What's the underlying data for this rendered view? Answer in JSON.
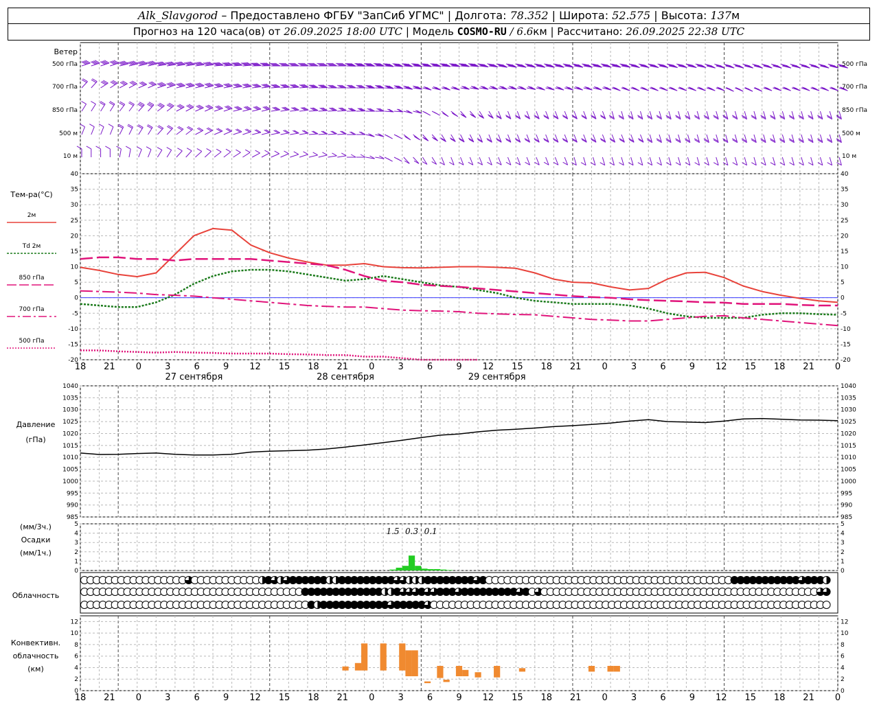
{
  "header": {
    "station": "Alk_Slavgorod",
    "provider_text": "– Предоставлено ФГБУ \"ЗапСиб УГМС\"",
    "lon_label": "Долгота:",
    "lon_value": "78.352",
    "lat_label": "Широта:",
    "lat_value": "52.575",
    "alt_label": "Высота:",
    "alt_value": "137",
    "alt_unit": "м",
    "forecast_text": "Прогноз на 120 часа(ов) от",
    "forecast_date": "26.09.2025 18:00 UTC",
    "model_label": "| Модель",
    "model_name": "COSMO-RU",
    "model_res": "/ 6.6",
    "model_res_unit": "км",
    "calc_label": "| Рассчитано:",
    "calc_date": "26.09.2025 22:38 UTC"
  },
  "labels": {
    "wind": "Ветер",
    "wind_levels": [
      "500 гПа",
      "700 гПа",
      "850 гПа",
      "500 м",
      "10 м"
    ],
    "temp": "Тем-ра(°C)",
    "legend": [
      {
        "text": "2м",
        "color": "#e8423a",
        "dash": "solid"
      },
      {
        "text": "Td 2м",
        "color": "#1a7a1a",
        "dash": "dot"
      },
      {
        "text": "850 гПа",
        "color": "#e0137a",
        "dash": "long"
      },
      {
        "text": "700 гПа",
        "color": "#e0137a",
        "dash": "dashdot"
      },
      {
        "text": "500 гПа",
        "color": "#e0137a",
        "dash": "dense"
      }
    ],
    "pressure": "Давление",
    "pressure_unit": "(гПа)",
    "precip_top": "(мм/3ч.)",
    "precip_mid": "Осадки",
    "precip_bot": "(мм/1ч.)",
    "cloud": "Облачность",
    "conv_1": "Конвективн.",
    "conv_2": "облачность",
    "conv_3": "(км)",
    "dates": [
      "27 сентября",
      "28 сентября",
      "29 сентября"
    ],
    "hour_ticks": [
      "18",
      "21",
      "0",
      "3",
      "6",
      "9",
      "12",
      "15",
      "18",
      "21",
      "0",
      "3",
      "6",
      "9",
      "12",
      "15",
      "18",
      "21",
      "0",
      "3",
      "6",
      "9",
      "12",
      "15",
      "18",
      "21",
      "0"
    ]
  },
  "colors": {
    "wind": "#7a17c8",
    "t2m": "#e8423a",
    "td": "#1a7a1a",
    "pres_levels": "#e0137a",
    "precip": "#22cc22",
    "convective": "#f08a30"
  },
  "chart_data": [
    {
      "type": "line",
      "title": "Тем-ра(°C)",
      "x_unit": "hours from 26.09.2025 18:00 UTC",
      "ylim": [
        -20,
        40
      ],
      "series": [
        {
          "name": "2м",
          "x": [
            0,
            3,
            6,
            9,
            12,
            15,
            18,
            21,
            24,
            27,
            30,
            33,
            36,
            39,
            42,
            45,
            48,
            51,
            54,
            57,
            60,
            63,
            66,
            69,
            72,
            75,
            78,
            81,
            84,
            87,
            90,
            93,
            96,
            99,
            102,
            105,
            108,
            111,
            114,
            117,
            120
          ],
          "values": [
            9.8,
            8.8,
            7.5,
            6.8,
            8,
            14,
            20,
            22.3,
            21.8,
            17,
            14.5,
            12.8,
            11.5,
            10.5,
            10.5,
            11,
            10,
            9.7,
            9.6,
            9.8,
            10,
            10,
            9.8,
            9.5,
            8,
            6,
            5,
            4.8,
            3.5,
            2.5,
            3,
            6,
            8,
            8.2,
            6.5,
            3.8,
            2,
            0.8,
            -0.2,
            -1,
            -1.5
          ]
        },
        {
          "name": "Td 2м",
          "x": [
            0,
            3,
            6,
            9,
            12,
            15,
            18,
            21,
            24,
            27,
            30,
            33,
            36,
            39,
            42,
            45,
            48,
            51,
            54,
            57,
            60,
            63,
            66,
            69,
            72,
            75,
            78,
            81,
            84,
            87,
            90,
            93,
            96,
            99,
            102,
            105,
            108,
            111,
            114,
            117,
            120
          ],
          "values": [
            -2,
            -2.5,
            -3,
            -3,
            -1.5,
            1,
            4.5,
            7,
            8.5,
            9,
            9,
            8.5,
            7.5,
            6.5,
            5.5,
            6,
            7,
            6,
            5,
            4,
            3.5,
            2.5,
            1.5,
            0,
            -1,
            -1.5,
            -2,
            -2,
            -2,
            -2.5,
            -3.5,
            -5,
            -6,
            -6.5,
            -6.5,
            -6.5,
            -5.5,
            -5,
            -5,
            -5.3,
            -5.5
          ]
        },
        {
          "name": "850 гПа",
          "x": [
            0,
            3,
            6,
            9,
            12,
            15,
            18,
            21,
            24,
            27,
            30,
            33,
            36,
            39,
            42,
            45,
            48,
            51,
            54,
            57,
            60,
            63,
            66,
            69,
            72,
            75,
            78,
            81,
            84,
            87,
            90,
            93,
            96,
            99,
            102,
            105,
            108,
            111,
            114,
            117,
            120
          ],
          "values": [
            12.5,
            13,
            13,
            12.5,
            12.5,
            12,
            12.5,
            12.5,
            12.5,
            12.5,
            12,
            11.5,
            11,
            10.5,
            9,
            7,
            5.5,
            5,
            4.2,
            3.8,
            3.5,
            3,
            2.5,
            2,
            1.5,
            1,
            0.5,
            0.2,
            0,
            -0.5,
            -0.8,
            -1,
            -1.2,
            -1.5,
            -1.6,
            -2,
            -2,
            -2,
            -2.3,
            -2.5,
            -2.5
          ]
        },
        {
          "name": "700 гПа",
          "x": [
            0,
            3,
            6,
            9,
            12,
            15,
            18,
            21,
            24,
            27,
            30,
            33,
            36,
            39,
            42,
            45,
            48,
            51,
            54,
            57,
            60,
            63,
            66,
            69,
            72,
            75,
            78,
            81,
            84,
            87,
            90,
            93,
            96,
            99,
            102,
            105,
            108,
            111,
            114,
            117,
            120
          ],
          "values": [
            2.2,
            2,
            1.8,
            1.5,
            1,
            0.8,
            0.5,
            0,
            -0.5,
            -1,
            -1.5,
            -2,
            -2.5,
            -2.8,
            -3,
            -3,
            -3.5,
            -4,
            -4.2,
            -4.3,
            -4.5,
            -5,
            -5.2,
            -5.4,
            -5.5,
            -6,
            -6.5,
            -7,
            -7.2,
            -7.5,
            -7.5,
            -7,
            -6.5,
            -6,
            -5.8,
            -6.5,
            -7,
            -7.5,
            -8,
            -8.5,
            -9
          ]
        },
        {
          "name": "500 гПа",
          "x": [
            0,
            3,
            6,
            9,
            12,
            15,
            18,
            21,
            24,
            27,
            30,
            33,
            36,
            39,
            42,
            45,
            48,
            51,
            54,
            57,
            60,
            63
          ],
          "values": [
            -17,
            -17,
            -17.3,
            -17.5,
            -17.7,
            -17.5,
            -17.7,
            -17.8,
            -18,
            -18,
            -18,
            -18.2,
            -18.3,
            -18.5,
            -18.5,
            -19,
            -19,
            -19.5,
            -20,
            -20,
            -20,
            -20
          ]
        }
      ]
    },
    {
      "type": "line",
      "title": "Давление",
      "ylabel": "(гПа)",
      "ylim": [
        985,
        1040
      ],
      "series": [
        {
          "name": "Давление",
          "x": [
            0,
            3,
            6,
            9,
            12,
            15,
            18,
            21,
            24,
            27,
            30,
            33,
            36,
            39,
            42,
            45,
            48,
            51,
            54,
            57,
            60,
            63,
            66,
            69,
            72,
            75,
            78,
            81,
            84,
            87,
            90,
            93,
            96,
            99,
            102,
            105,
            108,
            111,
            114,
            117,
            120
          ],
          "values": [
            1011.8,
            1011.2,
            1011.3,
            1011.6,
            1011.8,
            1011.3,
            1011,
            1011,
            1011.3,
            1012.2,
            1012.6,
            1012.8,
            1013,
            1013.5,
            1014.3,
            1015.2,
            1016.2,
            1017.2,
            1018.3,
            1019.3,
            1019.8,
            1020.7,
            1021.4,
            1021.8,
            1022.3,
            1022.9,
            1023.3,
            1023.8,
            1024.4,
            1025.2,
            1025.8,
            1025,
            1024.8,
            1024.6,
            1025.2,
            1026.1,
            1026.3,
            1026,
            1025.7,
            1025.6,
            1025.4
          ]
        }
      ]
    },
    {
      "type": "bar",
      "title": "Осадки",
      "ylabel": "(мм/1ч.)",
      "ylim": [
        0,
        5
      ],
      "x": [
        45,
        46,
        47,
        48,
        49,
        50,
        51,
        52,
        53,
        54,
        55,
        56,
        57,
        58
      ],
      "values": [
        0,
        0,
        0,
        0,
        0.1,
        0.3,
        0.5,
        1.6,
        0.5,
        0.2,
        0.15,
        0.15,
        0.1,
        0.05
      ],
      "annotations": [
        {
          "x": 49.5,
          "text": "1.5"
        },
        {
          "x": 52.5,
          "text": "0.3"
        },
        {
          "x": 55.5,
          "text": "0.1"
        }
      ]
    },
    {
      "type": "bar",
      "title": "Конвективн. облачность",
      "ylabel": "(км)",
      "ylim": [
        0,
        13
      ],
      "segments": [
        {
          "x": 42,
          "bottom": 3.5,
          "top": 4.2
        },
        {
          "x": 44,
          "bottom": 3.5,
          "top": 4.8
        },
        {
          "x": 45,
          "bottom": 3.5,
          "top": 8.2
        },
        {
          "x": 48,
          "bottom": 3.5,
          "top": 8.2
        },
        {
          "x": 51,
          "bottom": 3.5,
          "top": 8.2
        },
        {
          "x": 52,
          "bottom": 2.5,
          "top": 7
        },
        {
          "x": 53,
          "bottom": 2.5,
          "top": 7
        },
        {
          "x": 55,
          "bottom": 1.3,
          "top": 1.6
        },
        {
          "x": 57,
          "bottom": 2.2,
          "top": 4.3
        },
        {
          "x": 58,
          "bottom": 1.5,
          "top": 1.9
        },
        {
          "x": 60,
          "bottom": 2.5,
          "top": 4.3
        },
        {
          "x": 61,
          "bottom": 2.5,
          "top": 3.6
        },
        {
          "x": 63,
          "bottom": 2.3,
          "top": 3.2
        },
        {
          "x": 66,
          "bottom": 2.3,
          "top": 4.3
        },
        {
          "x": 70,
          "bottom": 3.3,
          "top": 3.9
        },
        {
          "x": 81,
          "bottom": 3.3,
          "top": 4.3
        },
        {
          "x": 84,
          "bottom": 3.3,
          "top": 4.3
        },
        {
          "x": 85,
          "bottom": 3.3,
          "top": 4.3
        }
      ]
    }
  ],
  "cloud_rows": [
    "00000000000000000300000000000213231111112211111111133222111111113100000000000000000000000000000000000000001111111111131112",
    "00000000000000000000000000000000000011111111111112213331331113111111111310300000000000000000000000000000000000000000000033",
    "00000000000000000000000000000000000001211111111111311111300000000000000000000000000000000000000000000000000000000000000000"
  ],
  "wind_rows": [
    {
      "level": "500 гПа",
      "dir": [
        250,
        250,
        255,
        255,
        260,
        260,
        262,
        265,
        265,
        268,
        270,
        270,
        270,
        270,
        272,
        272,
        275,
        275,
        275,
        275,
        275,
        278,
        280,
        280,
        280,
        280,
        280,
        280,
        280,
        282,
        282,
        282,
        282,
        285,
        285,
        285,
        285,
        285,
        285,
        285,
        285
      ],
      "speed": [
        40,
        42,
        45,
        45,
        45,
        45,
        45,
        45,
        45,
        45,
        45,
        45,
        45,
        45,
        45,
        45,
        45,
        45,
        45,
        45,
        45,
        45,
        45,
        45,
        45,
        45,
        45,
        45,
        45,
        45,
        45,
        45,
        45,
        45,
        45,
        45,
        45,
        45,
        45,
        45,
        45
      ]
    },
    {
      "level": "700 гПа",
      "dir": [
        220,
        235,
        240,
        245,
        250,
        255,
        255,
        258,
        260,
        262,
        265,
        265,
        268,
        270,
        270,
        272,
        275,
        280,
        285,
        285,
        280,
        280,
        280,
        282,
        285,
        285,
        285,
        285,
        290,
        290,
        290,
        290,
        290,
        290,
        295,
        295,
        290,
        290,
        290,
        290,
        290
      ],
      "speed": [
        20,
        25,
        30,
        32,
        35,
        35,
        35,
        35,
        35,
        35,
        35,
        35,
        35,
        35,
        35,
        35,
        35,
        35,
        30,
        30,
        30,
        30,
        30,
        30,
        30,
        30,
        30,
        30,
        30,
        30,
        30,
        30,
        30,
        30,
        30,
        30,
        30,
        30,
        30,
        30,
        30
      ]
    },
    {
      "level": "850 гПа",
      "dir": [
        210,
        210,
        215,
        220,
        230,
        240,
        245,
        250,
        255,
        255,
        260,
        262,
        265,
        265,
        268,
        270,
        275,
        285,
        300,
        310,
        320,
        330,
        340,
        340,
        340,
        340,
        340,
        340,
        345,
        345,
        345,
        345,
        345,
        345,
        345,
        345,
        345,
        345,
        345,
        345,
        345
      ],
      "speed": [
        10,
        15,
        20,
        25,
        25,
        25,
        25,
        25,
        25,
        25,
        25,
        25,
        25,
        25,
        25,
        25,
        20,
        20,
        15,
        15,
        15,
        15,
        15,
        15,
        15,
        15,
        15,
        15,
        15,
        15,
        15,
        15,
        15,
        15,
        15,
        15,
        15,
        15,
        15,
        15,
        15
      ]
    },
    {
      "level": "500 м",
      "dir": [
        200,
        200,
        205,
        210,
        220,
        230,
        240,
        245,
        250,
        255,
        258,
        260,
        265,
        265,
        270,
        285,
        300,
        310,
        320,
        330,
        335,
        340,
        340,
        340,
        340,
        340,
        340,
        340,
        340,
        340,
        345,
        345,
        345,
        345,
        345,
        345,
        345,
        345,
        345,
        345,
        345
      ],
      "speed": [
        10,
        10,
        15,
        20,
        20,
        20,
        20,
        20,
        20,
        20,
        20,
        20,
        20,
        20,
        15,
        15,
        15,
        15,
        15,
        15,
        15,
        15,
        15,
        15,
        15,
        15,
        15,
        15,
        15,
        15,
        15,
        15,
        15,
        15,
        15,
        15,
        15,
        15,
        15,
        15,
        15
      ]
    },
    {
      "level": "10 м",
      "dir": [
        180,
        180,
        190,
        200,
        210,
        220,
        225,
        230,
        235,
        240,
        245,
        250,
        255,
        260,
        270,
        280,
        300,
        320,
        330,
        340,
        340,
        340,
        340,
        340,
        340,
        340,
        345,
        345,
        345,
        345,
        345,
        345,
        345,
        345,
        345,
        345,
        345,
        345,
        345,
        345,
        345
      ],
      "speed": [
        10,
        10,
        10,
        10,
        10,
        10,
        10,
        10,
        10,
        10,
        10,
        10,
        10,
        10,
        10,
        10,
        10,
        10,
        10,
        10,
        10,
        10,
        10,
        10,
        10,
        10,
        10,
        10,
        10,
        10,
        10,
        10,
        10,
        10,
        10,
        10,
        10,
        10,
        10,
        10,
        10
      ]
    }
  ]
}
